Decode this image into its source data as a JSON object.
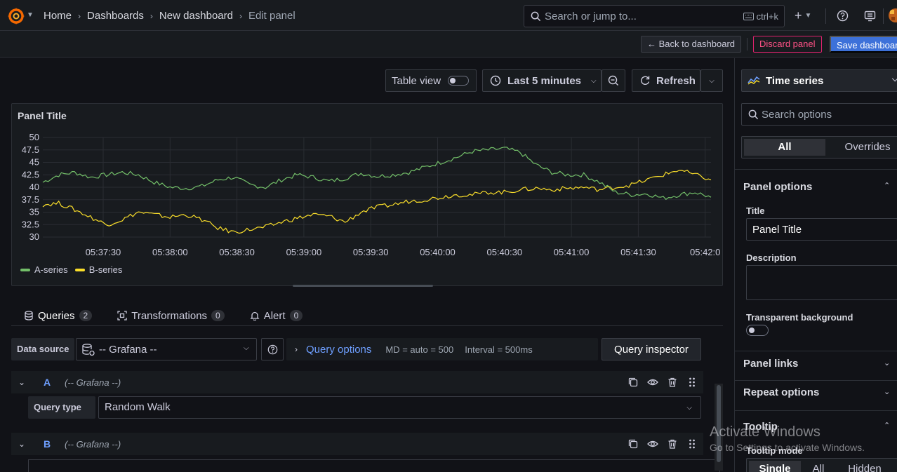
{
  "breadcrumb": [
    "Home",
    "Dashboards",
    "New dashboard",
    "Edit panel"
  ],
  "search": {
    "placeholder": "Search or jump to...",
    "shortcut": "ctrl+k"
  },
  "actions": {
    "back": "Back to dashboard",
    "discard": "Discard panel",
    "save": "Save dashboard"
  },
  "toolbar": {
    "table_view": "Table view",
    "time_range": "Last 5 minutes",
    "refresh": "Refresh"
  },
  "panel": {
    "title": "Panel Title"
  },
  "chart_data": {
    "type": "line",
    "x_ticks": [
      "05:37:30",
      "05:38:00",
      "05:38:30",
      "05:39:00",
      "05:39:30",
      "05:40:00",
      "05:40:30",
      "05:41:00",
      "05:41:30",
      "05:42:0"
    ],
    "y_ticks": [
      "50",
      "47.5",
      "45",
      "42.5",
      "40",
      "37.5",
      "35",
      "32.5",
      "30"
    ],
    "ylim": [
      30,
      50
    ],
    "grid": true,
    "legend": "bottom-left",
    "series": [
      {
        "name": "A-series",
        "color": "#73bf69",
        "values": [
          41,
          42.5,
          43,
          42,
          42.5,
          43,
          42.5,
          41,
          40,
          39.8,
          40.2,
          41.5,
          42,
          40.5,
          40,
          41.5,
          42.5,
          42,
          41.2,
          41.8,
          42.8,
          42.2,
          42.5,
          43,
          44,
          45,
          46,
          47.2,
          47.5,
          47.8,
          47,
          44.5,
          43,
          42.5,
          42.5,
          41,
          39,
          38.5,
          38.7,
          37.8,
          38.5,
          39,
          38
        ]
      },
      {
        "name": "B-series",
        "color": "#fade2a",
        "values": [
          36.5,
          36.8,
          35.5,
          34,
          32.5,
          33.5,
          35,
          34.5,
          34,
          34.5,
          33.5,
          31.8,
          31,
          31.5,
          32,
          33,
          33.8,
          34.5,
          34.2,
          33,
          35,
          36,
          36.5,
          37.2,
          37.5,
          38,
          38.5,
          38.5,
          39,
          39,
          39.5,
          39.8,
          39.5,
          39.8,
          40,
          39.5,
          40,
          40.5,
          41.5,
          42.5,
          43.5,
          42.5,
          41.5
        ]
      }
    ]
  },
  "tabs": [
    {
      "label": "Queries",
      "count": "2"
    },
    {
      "label": "Transformations",
      "count": "0"
    },
    {
      "label": "Alert",
      "count": "0"
    }
  ],
  "datasource": {
    "label": "Data source",
    "value": "-- Grafana --"
  },
  "query_options": {
    "label": "Query options",
    "md": "MD = auto = 500",
    "interval": "Interval = 500ms"
  },
  "query_inspector": "Query inspector",
  "queries": [
    {
      "letter": "A",
      "source": "(-- Grafana --)",
      "type_label": "Query type",
      "type_value": "Random Walk"
    },
    {
      "letter": "B",
      "source": "(-- Grafana --)"
    }
  ],
  "sidebar": {
    "visualization": "Time series",
    "search_placeholder": "Search options",
    "seg_all": "All",
    "seg_overrides": "Overrides",
    "panel_options": "Panel options",
    "title_label": "Title",
    "title_value": "Panel Title",
    "description_label": "Description",
    "transparent_label": "Transparent background",
    "panel_links": "Panel links",
    "repeat_options": "Repeat options",
    "tooltip": "Tooltip",
    "tooltip_mode": "Tooltip mode",
    "tooltip_modes": [
      "Single",
      "All",
      "Hidden"
    ]
  },
  "watermark": {
    "line1": "Activate Windows",
    "line2": "Go to Settings to activate Windows."
  }
}
